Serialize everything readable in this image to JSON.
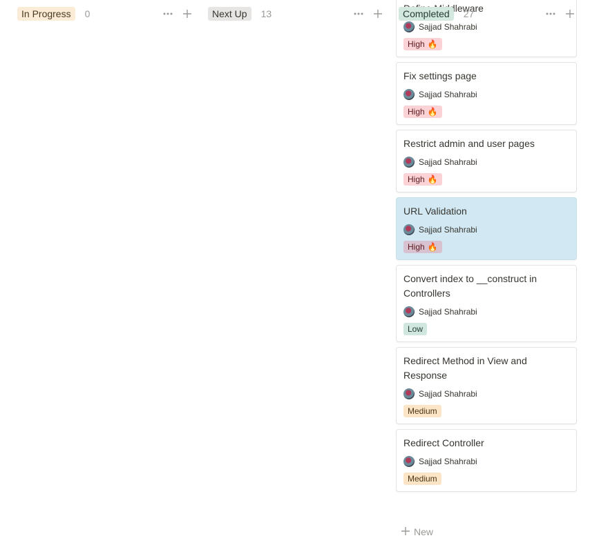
{
  "columns": {
    "in_progress": {
      "label": "In Progress",
      "count": "0"
    },
    "next_up": {
      "label": "Next Up",
      "count": "13"
    },
    "completed": {
      "label": "Completed",
      "count": "27",
      "new_label": "New",
      "cards": [
        {
          "title": "Define Middleware",
          "assignee": "Sajjad Shahrabi",
          "priority": "High",
          "priority_level": "high",
          "selected": false
        },
        {
          "title": "Fix settings page",
          "assignee": "Sajjad Shahrabi",
          "priority": "High",
          "priority_level": "high",
          "selected": false
        },
        {
          "title": "Restrict admin and user pages",
          "assignee": "Sajjad Shahrabi",
          "priority": "High",
          "priority_level": "high",
          "selected": false
        },
        {
          "title": "URL Validation",
          "assignee": "Sajjad Shahrabi",
          "priority": "High",
          "priority_level": "high",
          "selected": true
        },
        {
          "title": "Convert index to __construct in Controllers",
          "assignee": "Sajjad Shahrabi",
          "priority": "Low",
          "priority_level": "low",
          "selected": false
        },
        {
          "title": "Redirect Method in View and Response",
          "assignee": "Sajjad Shahrabi",
          "priority": "Medium",
          "priority_level": "medium",
          "selected": false
        },
        {
          "title": "Redirect Controller",
          "assignee": "Sajjad Shahrabi",
          "priority": "Medium",
          "priority_level": "medium",
          "selected": false
        }
      ]
    }
  },
  "colors": {
    "in_progress_tag": "#fbecd8",
    "next_up_tag": "#e6e5e3",
    "completed_tag": "#d3e8de",
    "high": "#fbd3d6",
    "low": "#cfe7de",
    "medium": "#fbe5c6",
    "selected_card": "#d2e9f3"
  },
  "icons": {
    "more": "more-horizontal-icon",
    "add": "plus-icon",
    "fire": "fire-icon",
    "avatar": "avatar"
  }
}
